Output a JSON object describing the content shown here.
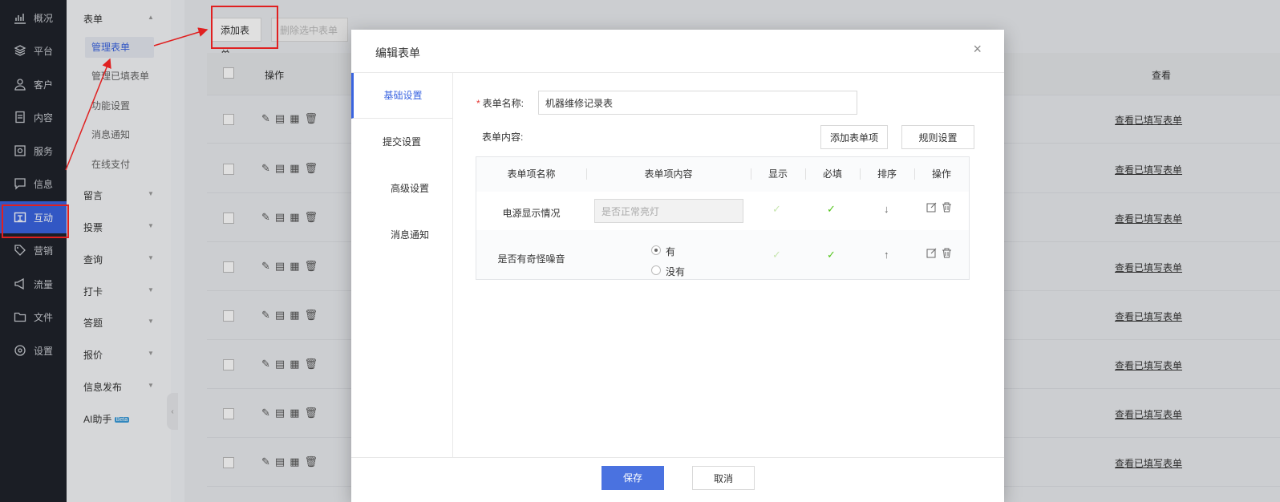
{
  "dark_nav": [
    {
      "label": "概况",
      "icon": "chart-icon"
    },
    {
      "label": "平台",
      "icon": "layers-icon"
    },
    {
      "label": "客户",
      "icon": "user-icon"
    },
    {
      "label": "内容",
      "icon": "document-icon"
    },
    {
      "label": "服务",
      "icon": "service-icon"
    },
    {
      "label": "信息",
      "icon": "message-icon"
    },
    {
      "label": "互动",
      "icon": "interact-icon"
    },
    {
      "label": "营销",
      "icon": "tag-icon"
    },
    {
      "label": "流量",
      "icon": "megaphone-icon"
    },
    {
      "label": "文件",
      "icon": "folder-icon"
    },
    {
      "label": "设置",
      "icon": "gear-icon"
    }
  ],
  "sub_nav": {
    "form_group": "表单",
    "form_items": [
      "管理表单",
      "管理已填表单",
      "功能设置",
      "消息通知",
      "在线支付"
    ],
    "groups": [
      "留言",
      "投票",
      "查询",
      "打卡",
      "答题",
      "报价",
      "信息发布"
    ],
    "ai": "AI助手",
    "ai_badge": "Beta"
  },
  "toolbar": {
    "add": "添加表单",
    "delete": "删除选中表单"
  },
  "list": {
    "col_ops": "操作",
    "col_view": "查看",
    "view_link": "查看已填写表单"
  },
  "modal": {
    "title": "编辑表单",
    "close": "×",
    "tabs": [
      "基础设置",
      "提交设置",
      "高级设置",
      "消息通知"
    ],
    "name_label": "表单名称:",
    "name_value": "机器维修记录表",
    "content_label": "表单内容:",
    "add_item": "添加表单项",
    "rule_setting": "规则设置",
    "table_headers": [
      "表单项名称",
      "表单项内容",
      "显示",
      "必填",
      "排序",
      "操作"
    ],
    "rows": [
      {
        "name": "电源显示情况",
        "placeholder": "是否正常亮灯",
        "sort": "↓"
      },
      {
        "name": "是否有奇怪噪音",
        "options": [
          "有",
          "没有"
        ],
        "sort": "↑"
      }
    ],
    "save": "保存",
    "cancel": "取消"
  },
  "colors": {
    "accent": "#3a64e0",
    "annotation": "#e02020",
    "sidebar": "#1f232b"
  }
}
